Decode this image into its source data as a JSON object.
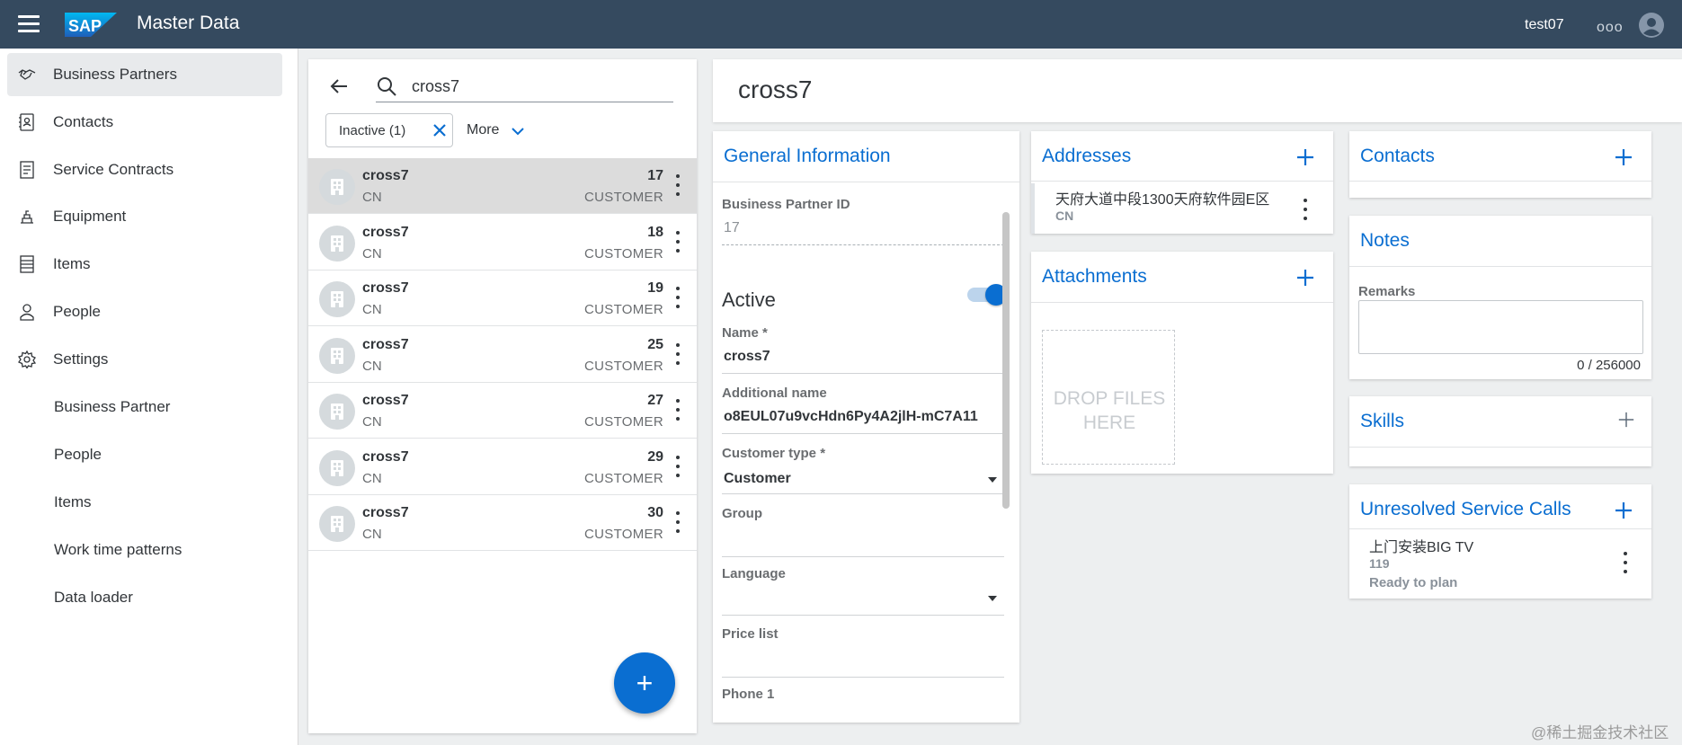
{
  "shell": {
    "logo_text": "SAP",
    "app_title": "Master Data",
    "user": "test07",
    "overflow": "ooo",
    "colors": {
      "shellbar": "#354a5f",
      "accent": "#0a6ed1"
    }
  },
  "sidenav": {
    "items": [
      {
        "label": "Business Partners",
        "icon": "handshake-icon",
        "selected": true
      },
      {
        "label": "Contacts",
        "icon": "contact-card-icon"
      },
      {
        "label": "Service Contracts",
        "icon": "contract-icon"
      },
      {
        "label": "Equipment",
        "icon": "equipment-icon"
      },
      {
        "label": "Items",
        "icon": "items-list-icon"
      },
      {
        "label": "People",
        "icon": "person-icon"
      },
      {
        "label": "Settings",
        "icon": "gear-icon"
      }
    ],
    "sub_items": [
      {
        "label": "Business Partner"
      },
      {
        "label": "People"
      },
      {
        "label": "Items"
      },
      {
        "label": "Work time patterns"
      },
      {
        "label": "Data loader"
      }
    ]
  },
  "list": {
    "search_value": "cross7",
    "filter_chip": "Inactive (1)",
    "more_label": "More",
    "rows": [
      {
        "name": "cross7",
        "country": "CN",
        "id": "17",
        "type": "CUSTOMER",
        "selected": true
      },
      {
        "name": "cross7",
        "country": "CN",
        "id": "18",
        "type": "CUSTOMER"
      },
      {
        "name": "cross7",
        "country": "CN",
        "id": "19",
        "type": "CUSTOMER"
      },
      {
        "name": "cross7",
        "country": "CN",
        "id": "25",
        "type": "CUSTOMER"
      },
      {
        "name": "cross7",
        "country": "CN",
        "id": "27",
        "type": "CUSTOMER"
      },
      {
        "name": "cross7",
        "country": "CN",
        "id": "29",
        "type": "CUSTOMER"
      },
      {
        "name": "cross7",
        "country": "CN",
        "id": "30",
        "type": "CUSTOMER"
      }
    ],
    "fab_label": "+"
  },
  "detail": {
    "title": "cross7",
    "general": {
      "title": "General Information",
      "bp_id_label": "Business Partner ID",
      "bp_id_value": "17",
      "active_label": "Active",
      "active": true,
      "name_label": "Name *",
      "name_value": "cross7",
      "additional_label": "Additional name",
      "additional_value": "o8EUL07u9vcHdn6Py4A2jlH-mC7A11",
      "customer_type_label": "Customer type *",
      "customer_type_value": "Customer",
      "group_label": "Group",
      "language_label": "Language",
      "price_list_label": "Price list",
      "phone_label": "Phone 1"
    },
    "addresses": {
      "title": "Addresses",
      "line": "天府大道中段1300天府软件园E区",
      "country": "CN"
    },
    "attachments": {
      "title": "Attachments",
      "drop_text": "DROP FILES HERE"
    },
    "contacts": {
      "title": "Contacts"
    },
    "notes": {
      "title": "Notes",
      "remarks_label": "Remarks",
      "remarks_count": "0 / 256000"
    },
    "skills": {
      "title": "Skills"
    },
    "service_calls": {
      "title": "Unresolved Service Calls",
      "item_title": "上门安装BIG TV",
      "item_number": "119",
      "item_status": "Ready to plan"
    }
  },
  "watermark": "@稀土掘金技术社区"
}
